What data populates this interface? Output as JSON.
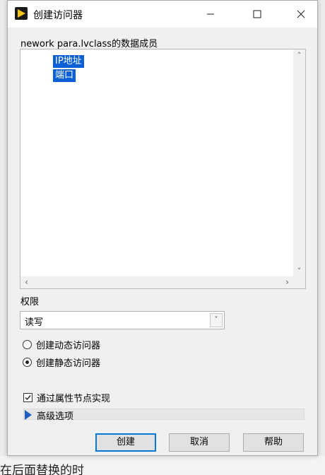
{
  "dialog": {
    "title": "创建访问器",
    "window_controls": {
      "minimize_icon": "minimize-icon",
      "maximize_icon": "maximize-icon",
      "close_icon": "close-icon"
    }
  },
  "members": {
    "label": "nework para.lvclass的数据成员",
    "items": [
      {
        "label": "IP地址",
        "selected": true
      },
      {
        "label": "端口",
        "selected": true
      }
    ],
    "selection_color": "#0a5fd6"
  },
  "permission": {
    "label": "权限",
    "selected": "读写"
  },
  "accessor_type": {
    "options": [
      {
        "label": "创建动态访问器",
        "checked": false
      },
      {
        "label": "创建静态访问器",
        "checked": true
      }
    ]
  },
  "property_node": {
    "label": "通过属性节点实现",
    "checked": true
  },
  "advanced": {
    "label": "高级选项",
    "expanded": false
  },
  "buttons": {
    "create": "创建",
    "cancel": "取消",
    "help": "帮助"
  },
  "background": {
    "partial_text": "在后面替换的时"
  }
}
